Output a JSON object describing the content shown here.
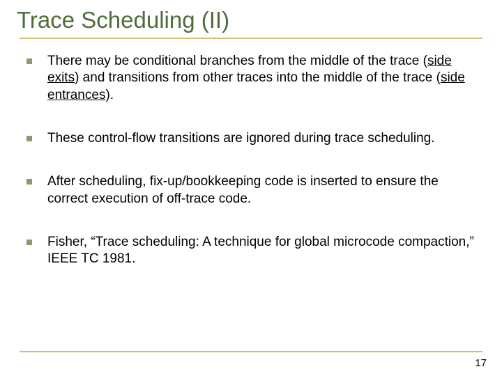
{
  "title": "Trace Scheduling (II)",
  "bullets": [
    {
      "pre": "There may be conditional branches from the middle of the trace (",
      "u1": "side exits",
      "mid": ") and transitions from other traces into the middle of the trace (",
      "u2": "side entrances",
      "post": ")."
    },
    {
      "text": "These control-flow transitions are ignored during trace scheduling."
    },
    {
      "text": "After scheduling, fix-up/bookkeeping code is inserted to ensure the correct execution of off-trace code."
    },
    {
      "pre": "Fisher, ",
      "q_open": "“",
      "ref_title": "Trace scheduling: A technique for global microcode compaction,",
      "q_close": "”",
      "ref_venue": " IEEE TC 1981."
    }
  ],
  "page_number": "17",
  "colors": {
    "title": "#4e6d3a",
    "rule": "#d7b97a",
    "bullet_square": "#8a9a6b"
  }
}
